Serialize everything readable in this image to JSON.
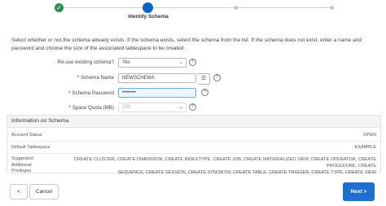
{
  "wizard": {
    "current_step_label": "Identify Schema",
    "done_icon": "check-icon"
  },
  "intro_text": "Select whether or not the schema already exists. If the schema exists, select the schema from the list. If the schema does not exist, enter a name and password and choose the size of the associated tablespace to be created.",
  "form": {
    "reuse_label": "Re-use existing schema?",
    "reuse_value": "Yes",
    "schema_name_label": "Schema Name",
    "schema_name_value": "NEWSCHEMA",
    "schema_password_label": "Schema Password",
    "schema_password_value": "••••••••",
    "space_quota_label": "Space Quota (MB)",
    "space_quota_value": "100",
    "required_marker": "*",
    "help_glyph": "?"
  },
  "info": {
    "title": "Information on Schema",
    "rows": [
      {
        "key": "Account Status",
        "value": "OPEN"
      },
      {
        "key": "Default Tablespace",
        "value": "EXAMPLE"
      },
      {
        "key": "Suggested Additional Privileges",
        "value_line1": "CREATE CLUSTER, CREATE DIMENSION, CREATE INDEXTYPE, CREATE JOB, CREATE MATERIALIZED VIEW, CREATE OPERATOR, CREATE PROCEDURE, CREATE",
        "value_line2": "SEQUENCE, CREATE SESSION, CREATE SYNONYM, CREATE TABLE, CREATE TRIGGER, CREATE TYPE, CREATE VIEW"
      }
    ]
  },
  "footer": {
    "back_glyph": "<",
    "cancel_label": "Cancel",
    "next_label": "Next",
    "next_glyph": ">"
  },
  "colors": {
    "step_done": "#2e8b57",
    "step_current": "#0a64c8",
    "primary_button": "#1f6fd0",
    "required": "#cc0000"
  }
}
